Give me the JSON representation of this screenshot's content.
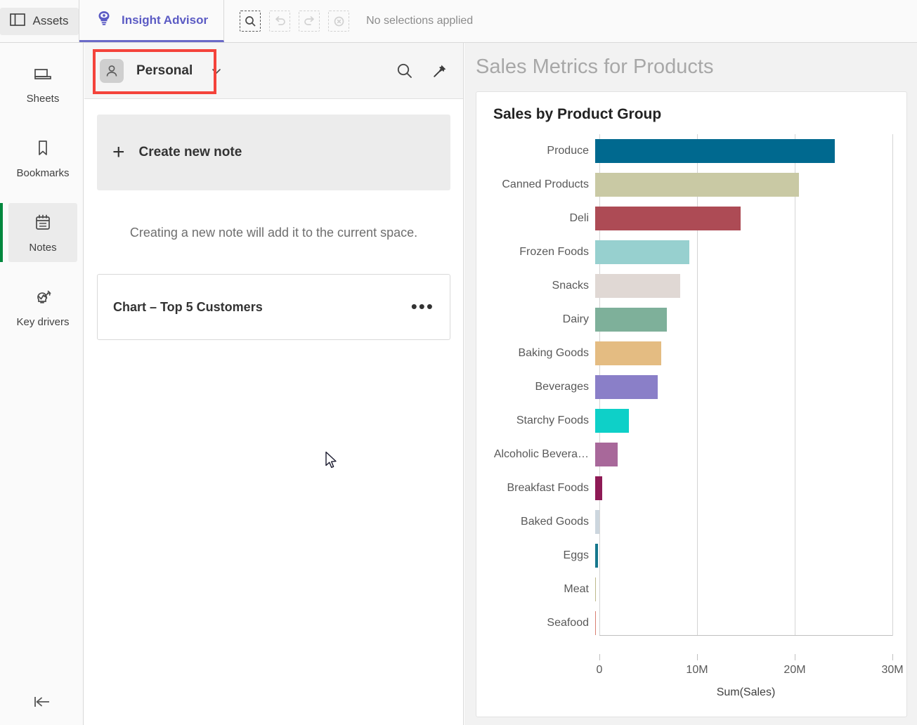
{
  "topbar": {
    "assets_label": "Assets",
    "assets_icon": "panel-icon",
    "insight_advisor_label": "Insight Advisor",
    "insight_advisor_icon": "lightbulb-eye-icon",
    "accent_color": "#5b5bc4",
    "selection_tools": [
      {
        "name": "selection-search-icon",
        "enabled": true
      },
      {
        "name": "undo-icon",
        "enabled": false
      },
      {
        "name": "redo-icon",
        "enabled": false
      },
      {
        "name": "clear-selections-icon",
        "enabled": false
      }
    ],
    "selection_status": "No selections applied"
  },
  "rail": {
    "items": [
      {
        "label": "Sheets",
        "icon": "sheets-icon",
        "active": false
      },
      {
        "label": "Bookmarks",
        "icon": "bookmark-icon",
        "active": false
      },
      {
        "label": "Notes",
        "icon": "notes-icon",
        "active": true
      },
      {
        "label": "Key drivers",
        "icon": "key-drivers-icon",
        "active": false
      }
    ],
    "active_indicator_color": "#00873d",
    "collapse_icon": "collapse-left-icon"
  },
  "notes_panel": {
    "space_name": "Personal",
    "space_avatar_icon": "person-icon",
    "dropdown_icon": "chevron-down-icon",
    "search_icon": "search-icon",
    "pin_icon": "pin-icon",
    "create_note_label": "Create new note",
    "create_note_icon": "plus-icon",
    "hint": "Creating a new note will add it to the current space.",
    "notes": [
      {
        "title": "Chart – Top 5 Customers",
        "menu_icon": "ellipsis-icon"
      }
    ],
    "highlight_color": "#f4433b"
  },
  "content": {
    "title": "Sales Metrics for Products"
  },
  "chart_data": {
    "type": "bar",
    "orientation": "horizontal",
    "title": "Sales by Product Group",
    "xlabel": "Sum(Sales)",
    "ylabel": "",
    "xlim": [
      0,
      30000000
    ],
    "xticks": [
      0,
      10000000,
      20000000,
      30000000
    ],
    "xtick_labels": [
      "0",
      "10M",
      "20M",
      "30M"
    ],
    "grid": true,
    "legend": "none",
    "categories": [
      "Produce",
      "Canned Products",
      "Deli",
      "Frozen Foods",
      "Snacks",
      "Dairy",
      "Baking Goods",
      "Beverages",
      "Starchy Foods",
      "Alcoholic Bevera…",
      "Breakfast Foods",
      "Baked Goods",
      "Eggs",
      "Meat",
      "Seafood"
    ],
    "values": [
      24200000,
      20600000,
      14700000,
      9500000,
      8600000,
      7200000,
      6700000,
      6300000,
      3400000,
      2300000,
      700000,
      450000,
      270000,
      60000,
      50000
    ],
    "colors": [
      "#00698f",
      "#c9c9a4",
      "#ad4b55",
      "#97d0cf",
      "#e0d8d4",
      "#7eb09a",
      "#e4bc82",
      "#8a7fc8",
      "#0ed0c8",
      "#a8689a",
      "#8e1a55",
      "#ccd6de",
      "#16778d",
      "#bdb98b",
      "#d97f72"
    ]
  }
}
